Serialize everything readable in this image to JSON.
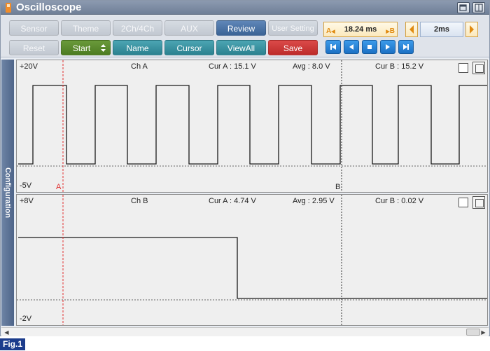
{
  "window": {
    "title": "Oscilloscope"
  },
  "toolbar": {
    "row1": [
      {
        "label": "Sensor",
        "style": "disabled"
      },
      {
        "label": "Theme",
        "style": "disabled"
      },
      {
        "label": "2Ch/4Ch",
        "style": "disabled"
      },
      {
        "label": "AUX",
        "style": "disabled"
      },
      {
        "label": "Review",
        "style": "blue"
      },
      {
        "label": "User Setting",
        "style": "disabled"
      }
    ],
    "row2": [
      {
        "label": "Reset",
        "style": "disabled"
      },
      {
        "label": "Start",
        "style": "green"
      },
      {
        "label": "Name",
        "style": "teal"
      },
      {
        "label": "Cursor",
        "style": "teal"
      },
      {
        "label": "ViewAll",
        "style": "teal"
      },
      {
        "label": "Save",
        "style": "red"
      }
    ],
    "ab_time": "18.24 ms",
    "ab_left": "A",
    "ab_right": "B",
    "time_div": "2ms",
    "play_controls": [
      "skip-to-start",
      "step-back",
      "stop",
      "play",
      "skip-to-end"
    ]
  },
  "sidebar": {
    "label": "Configuration"
  },
  "channels": [
    {
      "name": "Ch A",
      "top_label": "+20V",
      "bottom_label": "-5V",
      "cur_a": "Cur A : 15.1 V",
      "avg": "Avg : 8.0 V",
      "cur_b": "Cur B : 15.2 V",
      "cursor_a_label": "A",
      "cursor_b_label": "B",
      "signal": "square-wave"
    },
    {
      "name": "Ch B",
      "top_label": "+8V",
      "bottom_label": "-2V",
      "cur_a": "Cur A : 4.74 V",
      "avg": "Avg : 2.95 V",
      "cur_b": "Cur B : 0.02 V",
      "signal": "single-step-down"
    }
  ],
  "colors": {
    "cursor_a": "#e03030",
    "cursor_b": "#333333",
    "trace": "#1a1a1a",
    "fig_label_bg": "#1c3c8c"
  },
  "figure_label": "Fig.1"
}
